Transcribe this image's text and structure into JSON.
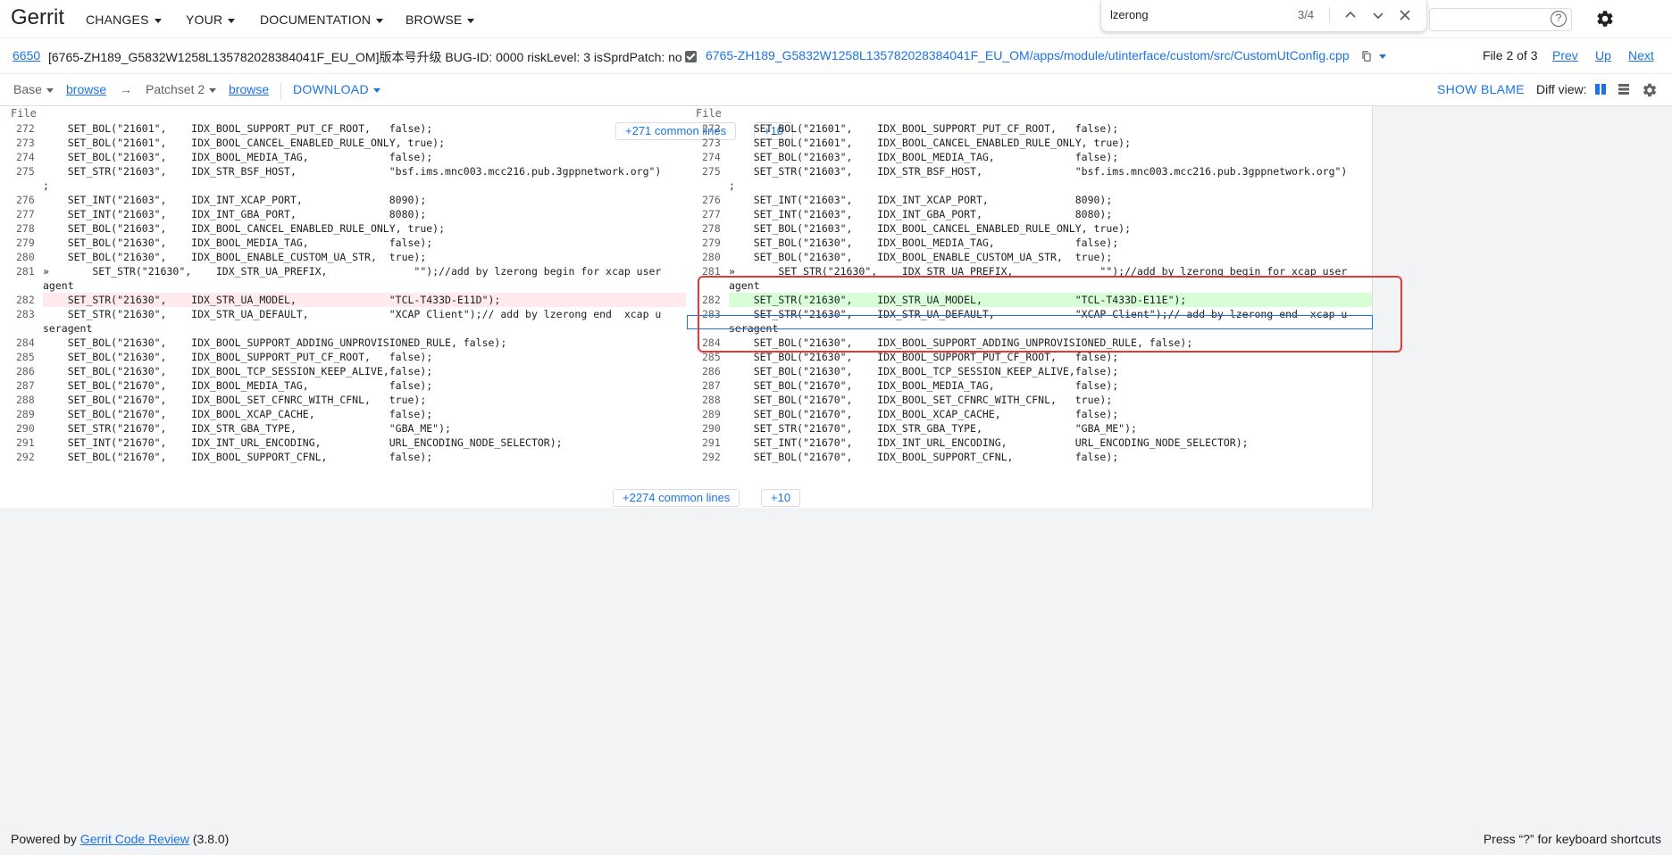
{
  "header": {
    "logo": "Gerrit",
    "nav": [
      {
        "label": "CHANGES"
      },
      {
        "label": "YOUR"
      },
      {
        "label": "DOCUMENTATION"
      },
      {
        "label": "BROWSE"
      }
    ],
    "help_glyph": "?"
  },
  "find_bar": {
    "query": "lzerong",
    "count": "3/4"
  },
  "change": {
    "number": "6650",
    "subject": "[6765-ZH189_G5832W1258L135782028384041F_EU_OM]版本号升级 BUG-ID: 0000 riskLevel: 3 isSprdPatch: no",
    "file_path": "6765-ZH189_G5832W1258L135782028384041F_EU_OM/apps/module/utinterface/custom/src/CustomUtConfig.cpp",
    "file_position": "File 2 of 3",
    "prev_label": "Prev",
    "up_label": "Up",
    "next_label": "Next"
  },
  "patchset_bar": {
    "base_label": "Base",
    "browse_left": "browse",
    "arrow": "→",
    "patchset_label": "Patchset 2",
    "browse_right": "browse",
    "download_label": "DOWNLOAD",
    "show_blame_label": "SHOW BLAME",
    "diff_view_label": "Diff view:"
  },
  "diff": {
    "file_header_left": "File",
    "file_header_right": "File",
    "top_common": "+271 common lines",
    "top_plus": "+10",
    "bottom_common": "+2274 common lines",
    "bottom_plus": "+10",
    "left_lines": [
      {
        "n": "272",
        "code": "    SET_BOL(\"21601\",    IDX_BOOL_SUPPORT_PUT_CF_ROOT,   false);"
      },
      {
        "n": "273",
        "code": "    SET_BOL(\"21601\",    IDX_BOOL_CANCEL_ENABLED_RULE_ONLY, true);"
      },
      {
        "n": "274",
        "code": "    SET_BOL(\"21603\",    IDX_BOOL_MEDIA_TAG,             false);"
      },
      {
        "n": "275",
        "code": "    SET_STR(\"21603\",    IDX_STR_BSF_HOST,               \"bsf.ims.mnc003.mcc216.pub.3gppnetwork.org\")"
      },
      {
        "n": "",
        "code": ";"
      },
      {
        "n": "276",
        "code": "    SET_INT(\"21603\",    IDX_INT_XCAP_PORT,              8090);"
      },
      {
        "n": "277",
        "code": "    SET_INT(\"21603\",    IDX_INT_GBA_PORT,               8080);"
      },
      {
        "n": "278",
        "code": "    SET_BOL(\"21603\",    IDX_BOOL_CANCEL_ENABLED_RULE_ONLY, true);"
      },
      {
        "n": "279",
        "code": "    SET_BOL(\"21630\",    IDX_BOOL_MEDIA_TAG,             false);"
      },
      {
        "n": "280",
        "code": "    SET_BOL(\"21630\",    IDX_BOOL_ENABLE_CUSTOM_UA_STR,  true);"
      },
      {
        "n": "281",
        "code": "»       SET_STR(\"21630\",    IDX_STR_UA_PREFIX,              \"\");//add by lzerong begin for xcap user"
      },
      {
        "n": "",
        "code": "agent"
      },
      {
        "n": "282",
        "code": "    SET_STR(\"21630\",    IDX_STR_UA_MODEL,               \"TCL-T433D-E11D\");"
      },
      {
        "n": "283",
        "code": "    SET_STR(\"21630\",    IDX_STR_UA_DEFAULT,             \"XCAP Client\");// add by lzerong end  xcap u"
      },
      {
        "n": "",
        "code": "seragent"
      },
      {
        "n": "284",
        "code": "    SET_BOL(\"21630\",    IDX_BOOL_SUPPORT_ADDING_UNPROVISIONED_RULE, false);"
      },
      {
        "n": "285",
        "code": "    SET_BOL(\"21630\",    IDX_BOOL_SUPPORT_PUT_CF_ROOT,   false);"
      },
      {
        "n": "286",
        "code": "    SET_BOL(\"21630\",    IDX_BOOL_TCP_SESSION_KEEP_ALIVE,false);"
      },
      {
        "n": "287",
        "code": "    SET_BOL(\"21670\",    IDX_BOOL_MEDIA_TAG,             false);"
      },
      {
        "n": "288",
        "code": "    SET_BOL(\"21670\",    IDX_BOOL_SET_CFNRC_WITH_CFNL,   true);"
      },
      {
        "n": "289",
        "code": "    SET_BOL(\"21670\",    IDX_BOOL_XCAP_CACHE,            false);"
      },
      {
        "n": "290",
        "code": "    SET_STR(\"21670\",    IDX_STR_GBA_TYPE,               \"GBA_ME\");"
      },
      {
        "n": "291",
        "code": "    SET_INT(\"21670\",    IDX_INT_URL_ENCODING,           URL_ENCODING_NODE_SELECTOR);"
      },
      {
        "n": "292",
        "code": "    SET_BOL(\"21670\",    IDX_BOOL_SUPPORT_CFNL,          false);"
      }
    ],
    "right_lines": [
      {
        "n": "272",
        "code": "    SET_BOL(\"21601\",    IDX_BOOL_SUPPORT_PUT_CF_ROOT,   false);"
      },
      {
        "n": "273",
        "code": "    SET_BOL(\"21601\",    IDX_BOOL_CANCEL_ENABLED_RULE_ONLY, true);"
      },
      {
        "n": "274",
        "code": "    SET_BOL(\"21603\",    IDX_BOOL_MEDIA_TAG,             false);"
      },
      {
        "n": "275",
        "code": "    SET_STR(\"21603\",    IDX_STR_BSF_HOST,               \"bsf.ims.mnc003.mcc216.pub.3gppnetwork.org\")"
      },
      {
        "n": "",
        "code": ";"
      },
      {
        "n": "276",
        "code": "    SET_INT(\"21603\",    IDX_INT_XCAP_PORT,              8090);"
      },
      {
        "n": "277",
        "code": "    SET_INT(\"21603\",    IDX_INT_GBA_PORT,               8080);"
      },
      {
        "n": "278",
        "code": "    SET_BOL(\"21603\",    IDX_BOOL_CANCEL_ENABLED_RULE_ONLY, true);"
      },
      {
        "n": "279",
        "code": "    SET_BOL(\"21630\",    IDX_BOOL_MEDIA_TAG,             false);"
      },
      {
        "n": "280",
        "code": "    SET_BOL(\"21630\",    IDX_BOOL_ENABLE_CUSTOM_UA_STR,  true);"
      },
      {
        "n": "281",
        "code": "»       SET_STR(\"21630\",    IDX_STR_UA_PREFIX,              \"\");//add by lzerong begin for xcap user"
      },
      {
        "n": "",
        "code": "agent"
      },
      {
        "n": "282",
        "code": "    SET_STR(\"21630\",    IDX_STR_UA_MODEL,               \"TCL-T433D-E11E\");"
      },
      {
        "n": "283",
        "code": "    SET_STR(\"21630\",    IDX_STR_UA_DEFAULT,             \"XCAP Client\");// add by lzerong end  xcap u"
      },
      {
        "n": "",
        "code": "seragent"
      },
      {
        "n": "284",
        "code": "    SET_BOL(\"21630\",    IDX_BOOL_SUPPORT_ADDING_UNPROVISIONED_RULE, false);"
      },
      {
        "n": "285",
        "code": "    SET_BOL(\"21630\",    IDX_BOOL_SUPPORT_PUT_CF_ROOT,   false);"
      },
      {
        "n": "286",
        "code": "    SET_BOL(\"21630\",    IDX_BOOL_TCP_SESSION_KEEP_ALIVE,false);"
      },
      {
        "n": "287",
        "code": "    SET_BOL(\"21670\",    IDX_BOOL_MEDIA_TAG,             false);"
      },
      {
        "n": "288",
        "code": "    SET_BOL(\"21670\",    IDX_BOOL_SET_CFNRC_WITH_CFNL,   true);"
      },
      {
        "n": "289",
        "code": "    SET_BOL(\"21670\",    IDX_BOOL_XCAP_CACHE,            false);"
      },
      {
        "n": "290",
        "code": "    SET_STR(\"21670\",    IDX_STR_GBA_TYPE,               \"GBA_ME\");"
      },
      {
        "n": "291",
        "code": "    SET_INT(\"21670\",    IDX_INT_URL_ENCODING,           URL_ENCODING_NODE_SELECTOR);"
      },
      {
        "n": "292",
        "code": "    SET_BOL(\"21670\",    IDX_BOOL_SUPPORT_CFNL,          false);"
      }
    ]
  },
  "footer": {
    "powered_prefix": "Powered by",
    "powered_link": "Gerrit Code Review",
    "version": "(3.8.0)",
    "shortcuts": "Press “?” for keyboard shortcuts"
  },
  "colors": {
    "accent": "#1a73e8",
    "deleted_bg": "#ffebee",
    "added_bg": "#d8fed8",
    "annotation_box": "#e53935"
  }
}
